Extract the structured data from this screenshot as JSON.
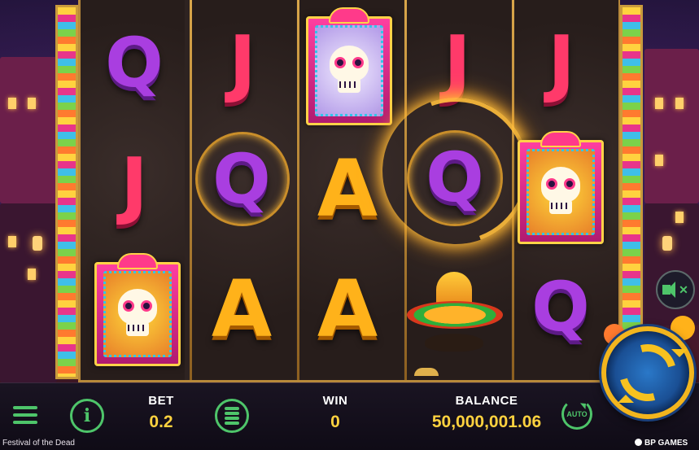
{
  "game": {
    "title": "Festival of the Dead",
    "brand": "BP GAMES"
  },
  "reels": [
    [
      "Q",
      "J",
      "skull-yellow"
    ],
    [
      "J",
      "Q",
      "A"
    ],
    [
      "skull-white",
      "A",
      "A"
    ],
    [
      "J",
      "Q",
      "sombrero"
    ],
    [
      "J",
      "skull-yellow",
      "Q"
    ]
  ],
  "hud": {
    "bet_label": "BET",
    "bet_value": "0.2",
    "win_label": "WIN",
    "win_value": "0",
    "balance_label": "BALANCE",
    "balance_value": "50,000,001.06",
    "auto_label": "AUTO"
  },
  "icons": {
    "menu": "hamburger-menu-icon",
    "info": "info-icon",
    "stake": "coin-stack-icon",
    "auto": "autoplay-icon",
    "spin": "spin-arrows-icon",
    "sound": "sound-muted-icon"
  },
  "colors": {
    "accent_green": "#4ec56a",
    "value_gold": "#ffd23f",
    "frame_gold": "#b8893a"
  }
}
